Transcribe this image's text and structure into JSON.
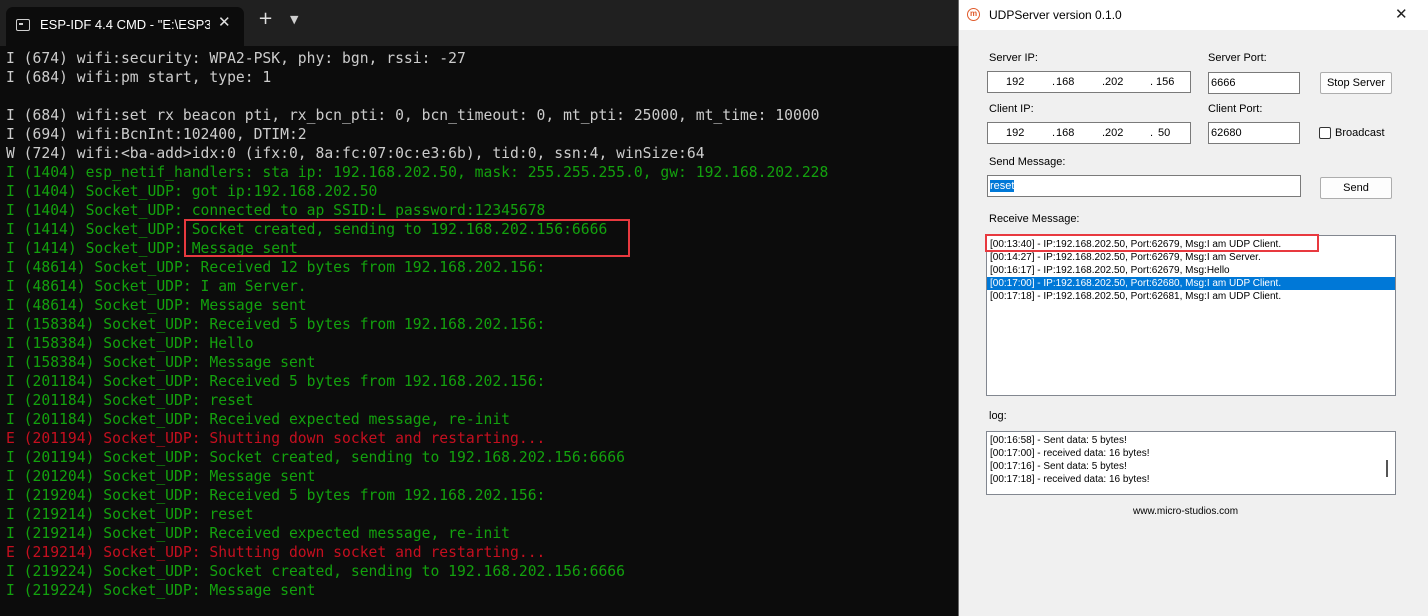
{
  "terminal": {
    "tab_title": "ESP-IDF 4.4 CMD - \"E:\\ESP32_S",
    "tab_close": "✕",
    "new_tab": "+",
    "dropdown": "⌄",
    "lines": [
      {
        "text": "I (674) wifi:security: WPA2-PSK, phy: bgn, rssi: -27",
        "color": "white"
      },
      {
        "text": "I (684) wifi:pm start, type: 1",
        "color": "white"
      },
      {
        "text": "",
        "color": "white"
      },
      {
        "text": "I (684) wifi:set rx beacon pti, rx_bcn_pti: 0, bcn_timeout: 0, mt_pti: 25000, mt_time: 10000",
        "color": "white"
      },
      {
        "text": "I (694) wifi:BcnInt:102400, DTIM:2",
        "color": "white"
      },
      {
        "text": "W (724) wifi:<ba-add>idx:0 (ifx:0, 8a:fc:07:0c:e3:6b), tid:0, ssn:4, winSize:64",
        "color": "white"
      },
      {
        "text": "I (1404) esp_netif_handlers: sta ip: 192.168.202.50, mask: 255.255.255.0, gw: 192.168.202.228",
        "color": "green"
      },
      {
        "text": "I (1404) Socket_UDP: got ip:192.168.202.50",
        "color": "green"
      },
      {
        "text": "I (1404) Socket_UDP: connected to ap SSID:L password:12345678",
        "color": "green"
      },
      {
        "text": "I (1414) Socket_UDP: Socket created, sending to 192.168.202.156:6666",
        "color": "green"
      },
      {
        "text": "I (1414) Socket_UDP: Message sent",
        "color": "green"
      },
      {
        "text": "I (48614) Socket_UDP: Received 12 bytes from 192.168.202.156:",
        "color": "green"
      },
      {
        "text": "I (48614) Socket_UDP: I am Server.",
        "color": "green"
      },
      {
        "text": "I (48614) Socket_UDP: Message sent",
        "color": "green"
      },
      {
        "text": "I (158384) Socket_UDP: Received 5 bytes from 192.168.202.156:",
        "color": "green"
      },
      {
        "text": "I (158384) Socket_UDP: Hello",
        "color": "green"
      },
      {
        "text": "I (158384) Socket_UDP: Message sent",
        "color": "green"
      },
      {
        "text": "I (201184) Socket_UDP: Received 5 bytes from 192.168.202.156:",
        "color": "green"
      },
      {
        "text": "I (201184) Socket_UDP: reset",
        "color": "green"
      },
      {
        "text": "I (201184) Socket_UDP: Received expected message, re-init",
        "color": "green"
      },
      {
        "text": "E (201194) Socket_UDP: Shutting down socket and restarting...",
        "color": "red"
      },
      {
        "text": "I (201194) Socket_UDP: Socket created, sending to 192.168.202.156:6666",
        "color": "green"
      },
      {
        "text": "I (201204) Socket_UDP: Message sent",
        "color": "green"
      },
      {
        "text": "I (219204) Socket_UDP: Received 5 bytes from 192.168.202.156:",
        "color": "green"
      },
      {
        "text": "I (219214) Socket_UDP: reset",
        "color": "green"
      },
      {
        "text": "I (219214) Socket_UDP: Received expected message, re-init",
        "color": "green"
      },
      {
        "text": "E (219214) Socket_UDP: Shutting down socket and restarting...",
        "color": "red"
      },
      {
        "text": "I (219224) Socket_UDP: Socket created, sending to 192.168.202.156:6666",
        "color": "green"
      },
      {
        "text": "I (219224) Socket_UDP: Message sent",
        "color": "green"
      }
    ]
  },
  "app": {
    "title": "UDPServer version 0.1.0",
    "close": "✕",
    "server_ip_label": "Server IP:",
    "server_ip": [
      "192",
      "168",
      "202",
      "156"
    ],
    "server_port_label": "Server Port:",
    "server_port": "6666",
    "stop_server_label": "Stop Server",
    "client_ip_label": "Client IP:",
    "client_ip": [
      "192",
      "168",
      "202",
      "50"
    ],
    "client_port_label": "Client Port:",
    "client_port": "62680",
    "broadcast_label": "Broadcast",
    "broadcast_checked": false,
    "send_message_label": "Send Message:",
    "send_message_value": "reset",
    "send_label": "Send",
    "receive_message_label": "Receive Message:",
    "received": [
      "[00:13:40] - IP:192.168.202.50, Port:62679, Msg:I am UDP Client.",
      "[00:14:27] - IP:192.168.202.50, Port:62679, Msg:I am Server.",
      "[00:16:17] - IP:192.168.202.50, Port:62679, Msg:Hello",
      "[00:17:00] - IP:192.168.202.50, Port:62680, Msg:I am UDP Client.",
      "[00:17:18] - IP:192.168.202.50, Port:62681, Msg:I am UDP Client."
    ],
    "received_selected_index": 3,
    "log_label": "log:",
    "log": [
      "[00:16:58] - Sent data: 5 bytes!",
      "[00:17:00] - received data: 16 bytes!",
      "[00:17:16] - Sent data: 5 bytes!",
      "[00:17:18] - received data: 16 bytes!"
    ],
    "footer": "www.micro-studios.com",
    "accent_color": "#0078d7",
    "highlight_color": "#e8393f"
  }
}
